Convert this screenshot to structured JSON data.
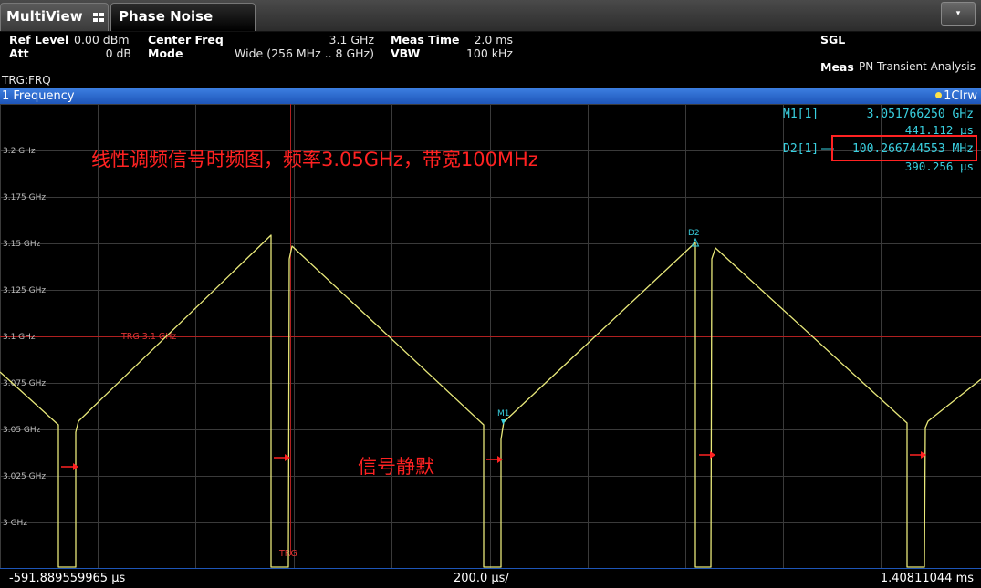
{
  "tabs": {
    "multiview": "MultiView",
    "phase_noise": "Phase Noise",
    "dropdown_glyph": "▾"
  },
  "settings": {
    "ref_level_label": "Ref Level",
    "ref_level_value": "0.00 dBm",
    "att_label": "Att",
    "att_value": "0 dB",
    "center_freq_label": "Center Freq",
    "center_freq_value": "3.1 GHz",
    "mode_label": "Mode",
    "mode_value": "Wide (256 MHz .. 8 GHz)",
    "meas_time_label": "Meas Time",
    "meas_time_value": "2.0 ms",
    "vbw_label": "VBW",
    "vbw_value": "100 kHz",
    "sweep_mode": "SGL",
    "meas_label": "Meas",
    "meas_value": "PN Transient Analysis",
    "trigger": "TRG:FRQ"
  },
  "window": {
    "title": "1 Frequency",
    "trace_indicator": "1Clrw"
  },
  "plot": {
    "y_ticks": [
      "3.2 GHz",
      "3.175 GHz",
      "3.15 GHz",
      "3.125 GHz",
      "3.1 GHz",
      "3.075 GHz",
      "3.05 GHz",
      "3.025 GHz",
      "3 GHz"
    ],
    "trigger_label": "TRG 3.1 GHz",
    "trg_marker_label": "TRG",
    "marker_m1": "M1",
    "marker_d2": "D2"
  },
  "markers": {
    "m1_label": "M1[1]",
    "m1_freq": "3.051766250 GHz",
    "m1_time": "441.112 µs",
    "d2_label": "D2[1]",
    "d2_freq": "100.266744553 MHz",
    "d2_time": "390.256 µs"
  },
  "annotations": {
    "caption": "线性调频信号时频图，频率3.05GHz，带宽100MHz",
    "silence": "信号静默"
  },
  "axis": {
    "start": "-591.889559965 µs",
    "per_div": "200.0 µs/",
    "stop": "1.40811044 ms"
  },
  "colors": {
    "trace": "#e8e87a",
    "marker": "#39d0e0",
    "trigger_line": "#c02020",
    "annotation": "#ff2222"
  }
}
